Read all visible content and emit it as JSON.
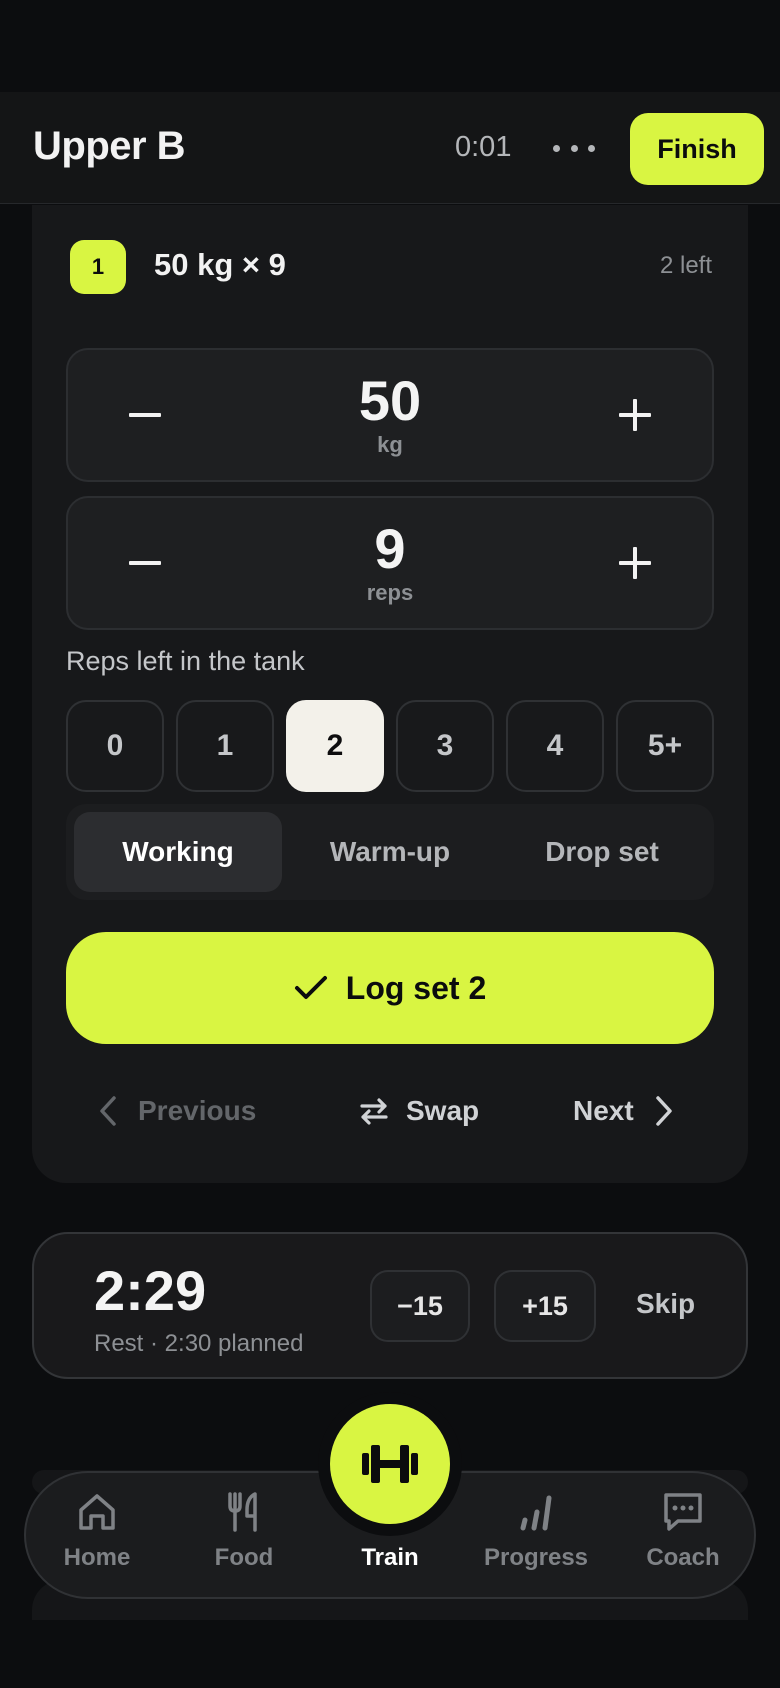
{
  "header": {
    "title": "Upper B",
    "elapsed": "0:01",
    "finish_label": "Finish"
  },
  "set": {
    "number": "1",
    "summary": "50 kg × 9",
    "remaining": "2 left"
  },
  "weight": {
    "value": "50",
    "unit": "kg"
  },
  "reps": {
    "value": "9",
    "unit": "reps"
  },
  "rir": {
    "label": "Reps left in the tank",
    "options": [
      "0",
      "1",
      "2",
      "3",
      "4",
      "5+"
    ],
    "selected": "2"
  },
  "set_type": {
    "options": [
      "Working",
      "Warm-up",
      "Drop set"
    ],
    "selected": "Working"
  },
  "log_button": "Log set 2",
  "nav": {
    "previous": "Previous",
    "swap": "Swap",
    "next": "Next"
  },
  "rest": {
    "countdown": "2:29",
    "subtitle": "Rest · 2:30 planned",
    "minus": "−15",
    "plus": "+15",
    "skip": "Skip"
  },
  "tabbar": {
    "items": [
      {
        "label": "Home",
        "icon": "home-icon"
      },
      {
        "label": "Food",
        "icon": "fork-knife-icon"
      },
      {
        "label": "Train",
        "icon": "dumbbell-icon"
      },
      {
        "label": "Progress",
        "icon": "bar-chart-icon"
      },
      {
        "label": "Coach",
        "icon": "chat-icon"
      }
    ],
    "active": "Train"
  },
  "colors": {
    "accent": "#d9f542",
    "background": "#0c0d0f",
    "card": "#17181a",
    "muted_text": "#8d9094"
  }
}
